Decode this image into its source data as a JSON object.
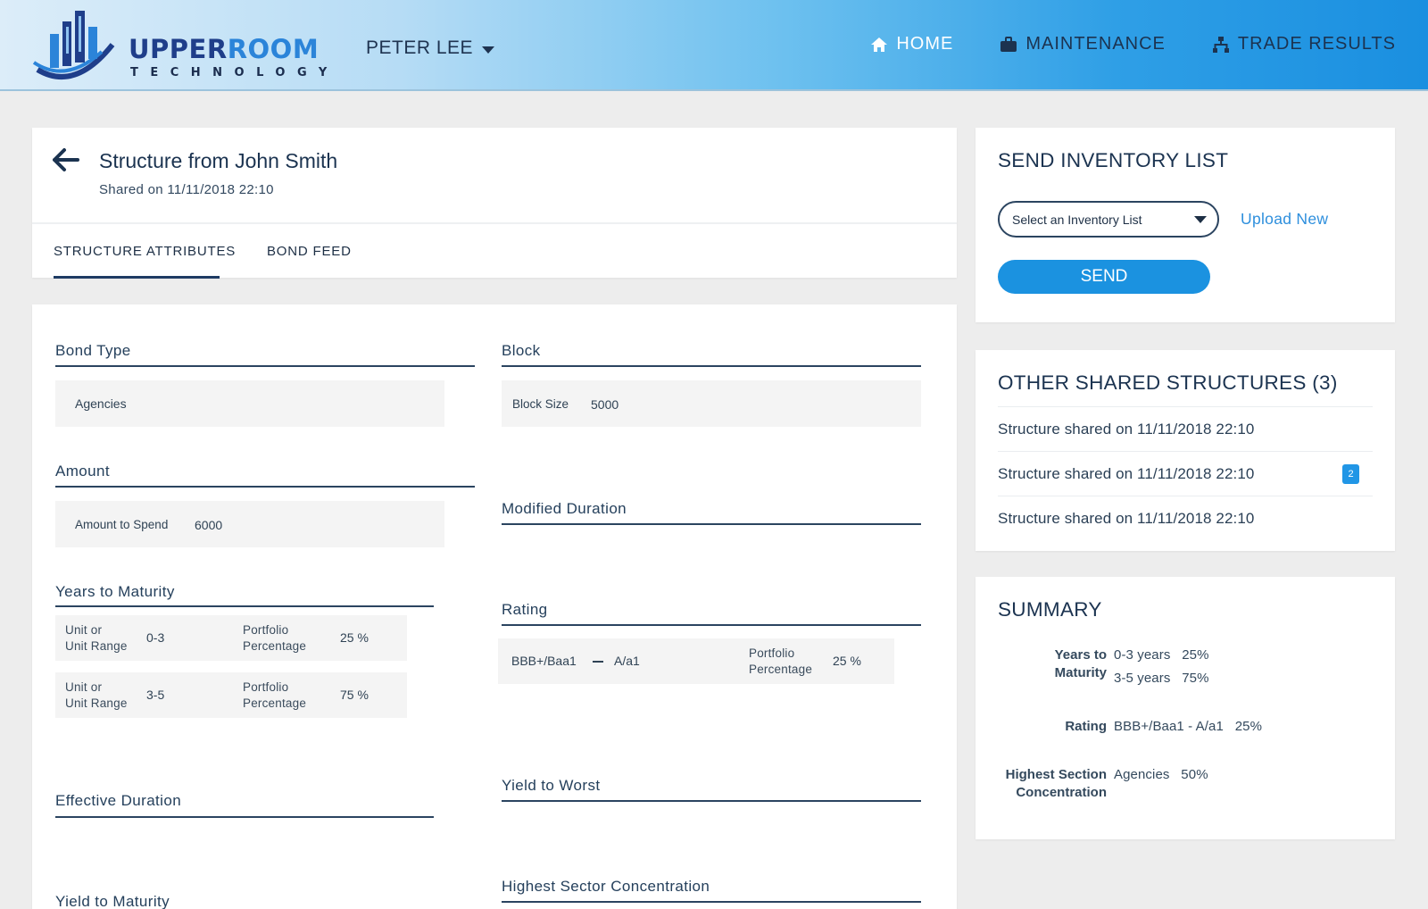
{
  "header": {
    "logo": {
      "word_upper": "UPPER",
      "word_room": "ROOM",
      "word_tech": "TECHNOLOGY"
    },
    "user_name": "PETER LEE",
    "nav": [
      {
        "label": "HOME",
        "icon": "home-icon",
        "active": true
      },
      {
        "label": "MAINTENANCE",
        "icon": "briefcase-icon",
        "active": false
      },
      {
        "label": "TRADE RESULTS",
        "icon": "sitemap-icon",
        "active": false
      }
    ]
  },
  "structure": {
    "title": "Structure from John Smith",
    "shared_on": "Shared on 11/11/2018  22:10",
    "tabs": [
      {
        "label": "STRUCTURE ATTRIBUTES",
        "active": true
      },
      {
        "label": "BOND FEED",
        "active": false
      }
    ]
  },
  "attributes": {
    "bond_type": {
      "label": "Bond Type",
      "value": "Agencies"
    },
    "amount": {
      "label": "Amount",
      "field_label": "Amount to Spend",
      "value": "6000"
    },
    "years_to_maturity": {
      "label": "Years to Maturity",
      "rows": [
        {
          "unit_label_1": "Unit or",
          "unit_label_2": "Unit Range",
          "unit_value": "0-3",
          "pct_label_1": "Portfolio",
          "pct_label_2": "Percentage",
          "pct_value": "25 %"
        },
        {
          "unit_label_1": "Unit or",
          "unit_label_2": "Unit Range",
          "unit_value": "3-5",
          "pct_label_1": "Portfolio",
          "pct_label_2": "Percentage",
          "pct_value": "75 %"
        }
      ]
    },
    "effective_duration": {
      "label": "Effective Duration"
    },
    "yield_to_maturity": {
      "label": "Yield to Maturity"
    },
    "block": {
      "label": "Block",
      "field_label": "Block Size",
      "value": "5000"
    },
    "modified_duration": {
      "label": "Modified Duration"
    },
    "rating": {
      "label": "Rating",
      "from": "BBB+/Baa1",
      "to": "A/a1",
      "pct_label_1": "Portfolio",
      "pct_label_2": "Percentage",
      "pct_value": "25 %"
    },
    "yield_to_worst": {
      "label": "Yield to Worst"
    },
    "highest_sector": {
      "label": "Highest Sector Concentration"
    }
  },
  "send_inventory": {
    "title": "SEND INVENTORY LIST",
    "select_placeholder": "Select an Inventory List",
    "upload_label": "Upload New",
    "send_label": "SEND"
  },
  "other_shared": {
    "title": "OTHER SHARED STRUCTURES (3)",
    "items": [
      {
        "text": "Structure shared on 11/11/2018  22:10",
        "badge": null
      },
      {
        "text": "Structure shared on 11/11/2018  22:10",
        "badge": "2"
      },
      {
        "text": "Structure shared on 11/11/2018  22:10",
        "badge": null
      }
    ]
  },
  "summary": {
    "title": "SUMMARY",
    "ytm_label_1": "Years to",
    "ytm_label_2": "Maturity",
    "ytm_values": [
      "0-3 years   25%",
      "3-5 years   75%"
    ],
    "rating_label": "Rating",
    "rating_value": "BBB+/Baa1 - A/a1   25%",
    "hsc_label_1": "Highest Section",
    "hsc_label_2": "Concentration",
    "hsc_value": "Agencies   50%"
  }
}
